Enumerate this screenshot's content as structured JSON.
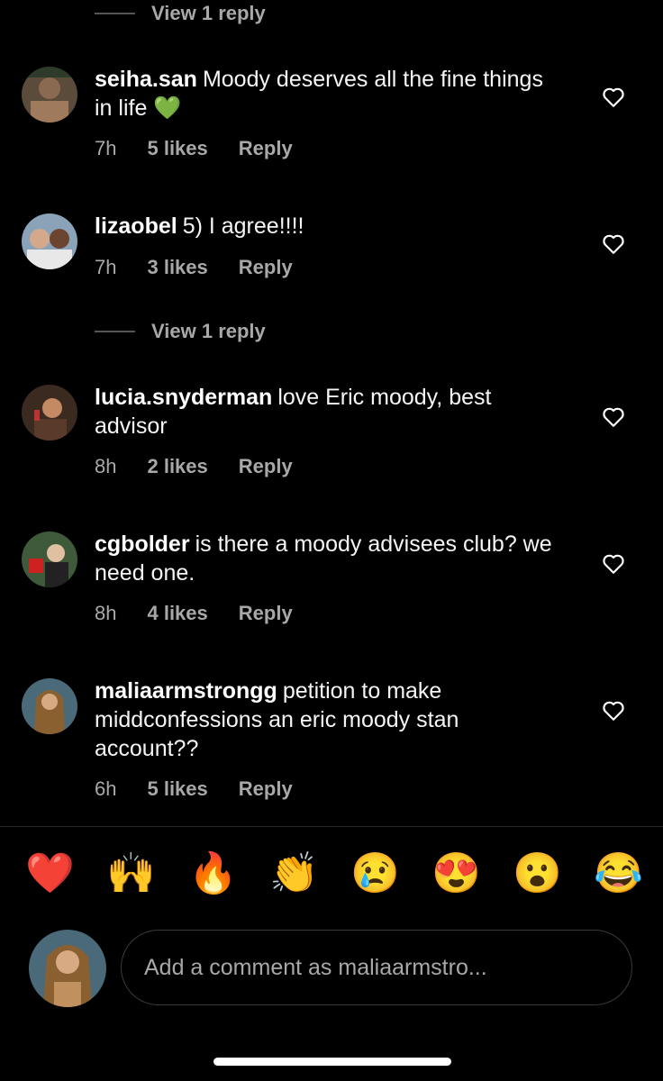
{
  "view_reply_top": "View 1 reply",
  "view_reply_mid": "View 1 reply",
  "comments": [
    {
      "user": "seiha.san",
      "text": "Moody deserves all the fine things in life 💚",
      "time": "7h",
      "likes": "5 likes",
      "reply": "Reply"
    },
    {
      "user": "lizaobel",
      "text": "5) I agree!!!!",
      "time": "7h",
      "likes": "3 likes",
      "reply": "Reply"
    },
    {
      "user": "lucia.snyderman",
      "text": "love Eric moody, best advisor",
      "time": "8h",
      "likes": "2 likes",
      "reply": "Reply"
    },
    {
      "user": "cgbolder",
      "text": "is there a moody advisees club? we need one.",
      "time": "8h",
      "likes": "4 likes",
      "reply": "Reply"
    },
    {
      "user": "maliaarmstrongg",
      "text": "petition to make middconfessions an eric moody stan account??",
      "time": "6h",
      "likes": "5 likes",
      "reply": "Reply"
    }
  ],
  "reactions": [
    "❤️",
    "🙌",
    "🔥",
    "👏",
    "😢",
    "😍",
    "😮",
    "😂"
  ],
  "comment_input": {
    "placeholder": "Add a comment as maliaarmstro..."
  },
  "colors": {
    "background": "#000000",
    "text": "#ffffff",
    "secondary": "#a8a8a8",
    "heart_icon": "#ffffff"
  },
  "icons": {
    "like": "heart-outline-icon"
  }
}
